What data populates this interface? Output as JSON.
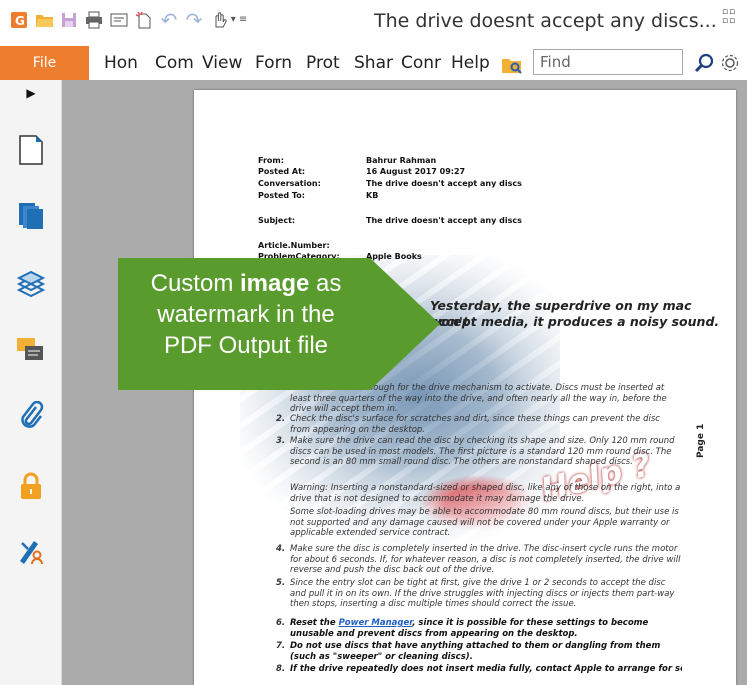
{
  "title_bar": {
    "window_title": "The drive doesnt accept any discs...",
    "icons": [
      "app-logo-icon",
      "open-folder-icon",
      "save-icon",
      "print-icon",
      "properties-icon",
      "new-icon",
      "undo-icon",
      "redo-icon",
      "hand-tool-icon",
      "customize-dropdown-icon"
    ]
  },
  "menu": {
    "file_label": "File",
    "items": [
      "Hon",
      "Com",
      "View",
      "Forn",
      "Prot",
      "Shar",
      "Conr",
      "Help"
    ],
    "find_placeholder": "Find"
  },
  "side_panel": {
    "icons": [
      "expand-arrow-icon",
      "page-icon",
      "pages-icon",
      "layers-icon",
      "comments-icon",
      "attachment-icon",
      "lock-icon",
      "signature-icon"
    ]
  },
  "callout": {
    "line1_pre": "Custom ",
    "line1_bold": "image",
    "line1_post": " as",
    "line2": "watermark in the",
    "line3": "PDF Output file",
    "color": "#5a9b2e"
  },
  "document": {
    "meta": [
      {
        "label": "From:",
        "value": "Bahrur Rahman"
      },
      {
        "label": "Posted At:",
        "value": "16 August 2017 09:27"
      },
      {
        "label": "Conversation:",
        "value": "The drive doesn't accept any discs"
      },
      {
        "label": "Posted To:",
        "value": "KB"
      },
      {
        "label": "Subject:",
        "value": "The drive doesn't accept any discs"
      },
      {
        "label": "Article.Number:",
        "value": ""
      },
      {
        "label": "ProblemCategory:",
        "value": "Apple Books"
      }
    ],
    "heading_line1": "Yesterday, the superdrive on my mac won't",
    "heading_line2": "accept media, it produces a noisy sound.",
    "item1": "Hold the disc far enough for the drive mechanism to activate. Discs must be inserted at least three quarters of the way into the drive, and often nearly all the way in, before the drive will accept them in.",
    "item2": "Check the disc's surface for scratches and dirt, since these things can prevent the disc from appearing on the desktop.",
    "item3": "Make sure the drive can read the disc by checking its shape and size. Only 120 mm round discs can be used in most models. The first picture is a standard 120 mm round disc. The second is an 80 mm small round disc. The others are nonstandard shaped discs.",
    "warning": "Warning: Inserting a nonstandard-sized or shaped disc, like any of those on the right, into a drive that is not designed to accommodate it may damage the drive.",
    "slot_note": "Some slot-loading drives may be able to accommodate 80 mm round discs, but their use is not supported and any damage caused will not be covered under your Apple warranty or applicable extended service contract.",
    "item4": "Make sure the disc is completely inserted in the drive. The disc-insert cycle runs the motor for about 6 seconds. If, for whatever reason, a disc is not completely inserted, the drive will reverse and push the disc back out of the drive.",
    "item5": "Since the entry slot can be tight at first, give the drive 1 or 2 seconds to accept the disc and pull it in on its own. If the drive struggles with injecting discs or injects them part-way then stops, inserting a disc multiple times should correct the issue.",
    "item6_pre": "Reset the ",
    "item6_link": "Power Manager",
    "item6_post": ", since it is possible for these settings to become unusable and prevent discs from appearing on the desktop.",
    "item7": "Do not use discs that have anything attached to them or dangling from them (such as \"sweeper\" or cleaning discs).",
    "item8": "If the drive repeatedly does not insert media fully, contact Apple to arrange for service.",
    "page_label": "Page 1",
    "watermark_text": "Help ?"
  },
  "colors": {
    "accent": "#ee7e2d",
    "side_icon_blue": "#1f6fb5",
    "canvas_gray": "#ababab"
  }
}
